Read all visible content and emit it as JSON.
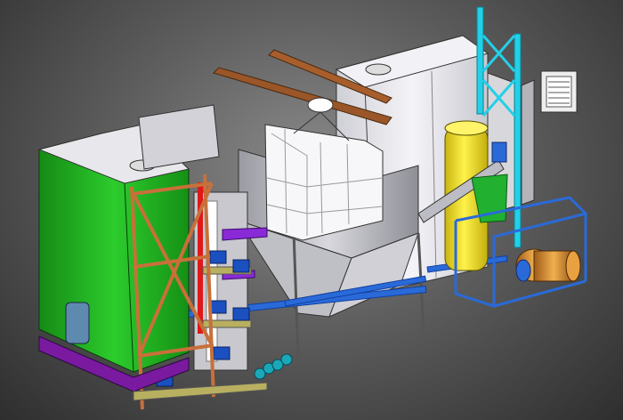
{
  "scene": {
    "kind": "cad-3d-render",
    "background": "#6e6e6e",
    "colors": {
      "green_tank": "#1fb51f",
      "white_tank": "#e6e6ea",
      "frame_orange": "#c8703a",
      "pipe_blue": "#2a6ad8",
      "pipe_purple": "#8a2ad6",
      "pipe_red": "#e01818",
      "skid_purple": "#7a1aa0",
      "cyan_mast": "#22d0e8",
      "yellow_vessel": "#f2e020",
      "bracket_brown": "#8a4a22",
      "screw_green": "#22b030",
      "base_olive": "#b8b060"
    },
    "icons": [
      "vent-grille-icon",
      "manhole-hatch-icon",
      "pump-motor-icon",
      "valve-icon"
    ]
  }
}
